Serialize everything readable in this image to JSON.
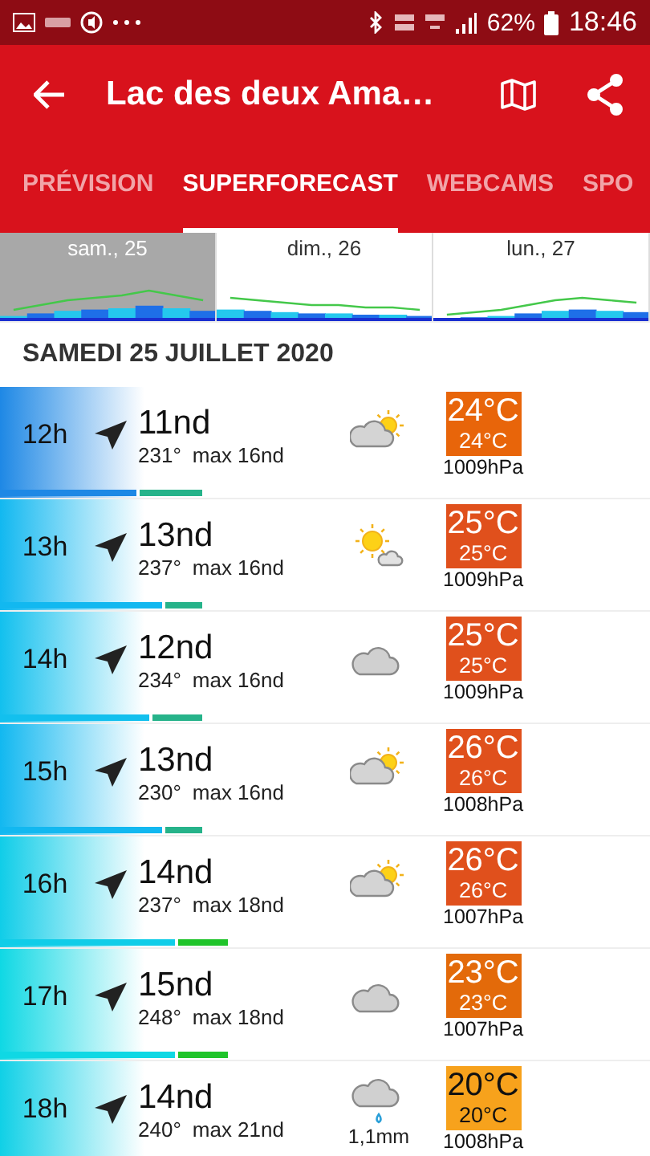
{
  "status_bar": {
    "battery": "62%",
    "time": "18:46"
  },
  "app_bar": {
    "title": "Lac des deux Ama…"
  },
  "tabs": [
    {
      "label": "PRÉVISION",
      "selected": false
    },
    {
      "label": "SUPERFORECAST",
      "selected": true
    },
    {
      "label": "WEBCAMS",
      "selected": false
    },
    {
      "label": "SPO",
      "selected": false
    }
  ],
  "days": [
    {
      "label": "sam., 25",
      "selected": true
    },
    {
      "label": "dim., 26",
      "selected": false
    },
    {
      "label": "lun., 27",
      "selected": false
    }
  ],
  "date_heading": "SAMEDI 25 JUILLET 2020",
  "rows": [
    {
      "hour": "12h",
      "speed": "11nd",
      "direction": "231°",
      "gust": "max 16nd",
      "wind_gradient": {
        "color": "#1e88e5"
      },
      "wind_bar": {
        "level": 0.21
      },
      "gust_bar": {
        "level": 0.31,
        "color": "#26b38a"
      },
      "weather": {
        "kind": "partly_cloudy"
      },
      "temp": "24°C",
      "feels": "24°C",
      "color": "#e8650a",
      "pressure": "1009hPa"
    },
    {
      "hour": "13h",
      "speed": "13nd",
      "direction": "237°",
      "gust": "max 16nd",
      "wind_gradient": {
        "color": "#12b8f0"
      },
      "wind_bar": {
        "level": 0.25
      },
      "gust_bar": {
        "level": 0.31,
        "color": "#26b38a"
      },
      "weather": {
        "kind": "sunny"
      },
      "temp": "25°C",
      "feels": "25°C",
      "color": "#e0501c",
      "pressure": "1009hPa"
    },
    {
      "hour": "14h",
      "speed": "12nd",
      "direction": "234°",
      "gust": "max 16nd",
      "wind_gradient": {
        "color": "#12c0ee"
      },
      "wind_bar": {
        "level": 0.23
      },
      "gust_bar": {
        "level": 0.31,
        "color": "#26b38a"
      },
      "weather": {
        "kind": "cloudy"
      },
      "temp": "25°C",
      "feels": "25°C",
      "color": "#e0501c",
      "pressure": "1009hPa"
    },
    {
      "hour": "15h",
      "speed": "13nd",
      "direction": "230°",
      "gust": "max 16nd",
      "wind_gradient": {
        "color": "#12b8f0"
      },
      "wind_bar": {
        "level": 0.25
      },
      "gust_bar": {
        "level": 0.31,
        "color": "#26b38a"
      },
      "weather": {
        "kind": "partly_cloudy"
      },
      "temp": "26°C",
      "feels": "26°C",
      "color": "#e0501c",
      "pressure": "1008hPa"
    },
    {
      "hour": "16h",
      "speed": "14nd",
      "direction": "237°",
      "gust": "max 18nd",
      "wind_gradient": {
        "color": "#10cde8"
      },
      "wind_bar": {
        "level": 0.27
      },
      "gust_bar": {
        "level": 0.35,
        "color": "#1fc42a"
      },
      "weather": {
        "kind": "partly_cloudy"
      },
      "temp": "26°C",
      "feels": "26°C",
      "color": "#e0501c",
      "pressure": "1007hPa"
    },
    {
      "hour": "17h",
      "speed": "15nd",
      "direction": "248°",
      "gust": "max 18nd",
      "wind_gradient": {
        "color": "#0fd8e4"
      },
      "wind_bar": {
        "level": 0.27
      },
      "gust_bar": {
        "level": 0.35,
        "color": "#1fc42a"
      },
      "weather": {
        "kind": "cloudy"
      },
      "temp": "23°C",
      "feels": "23°C",
      "color": "#e36a0a",
      "pressure": "1007hPa"
    },
    {
      "hour": "18h",
      "speed": "14nd",
      "direction": "240°",
      "gust": "max 21nd",
      "wind_gradient": {
        "color": "#10d0e6"
      },
      "weather": {
        "kind": "rain",
        "precip": "1,1mm"
      },
      "temp": "20°C",
      "feels": "20°C",
      "color": "#f7a21c",
      "pressure": "1008hPa"
    }
  ]
}
